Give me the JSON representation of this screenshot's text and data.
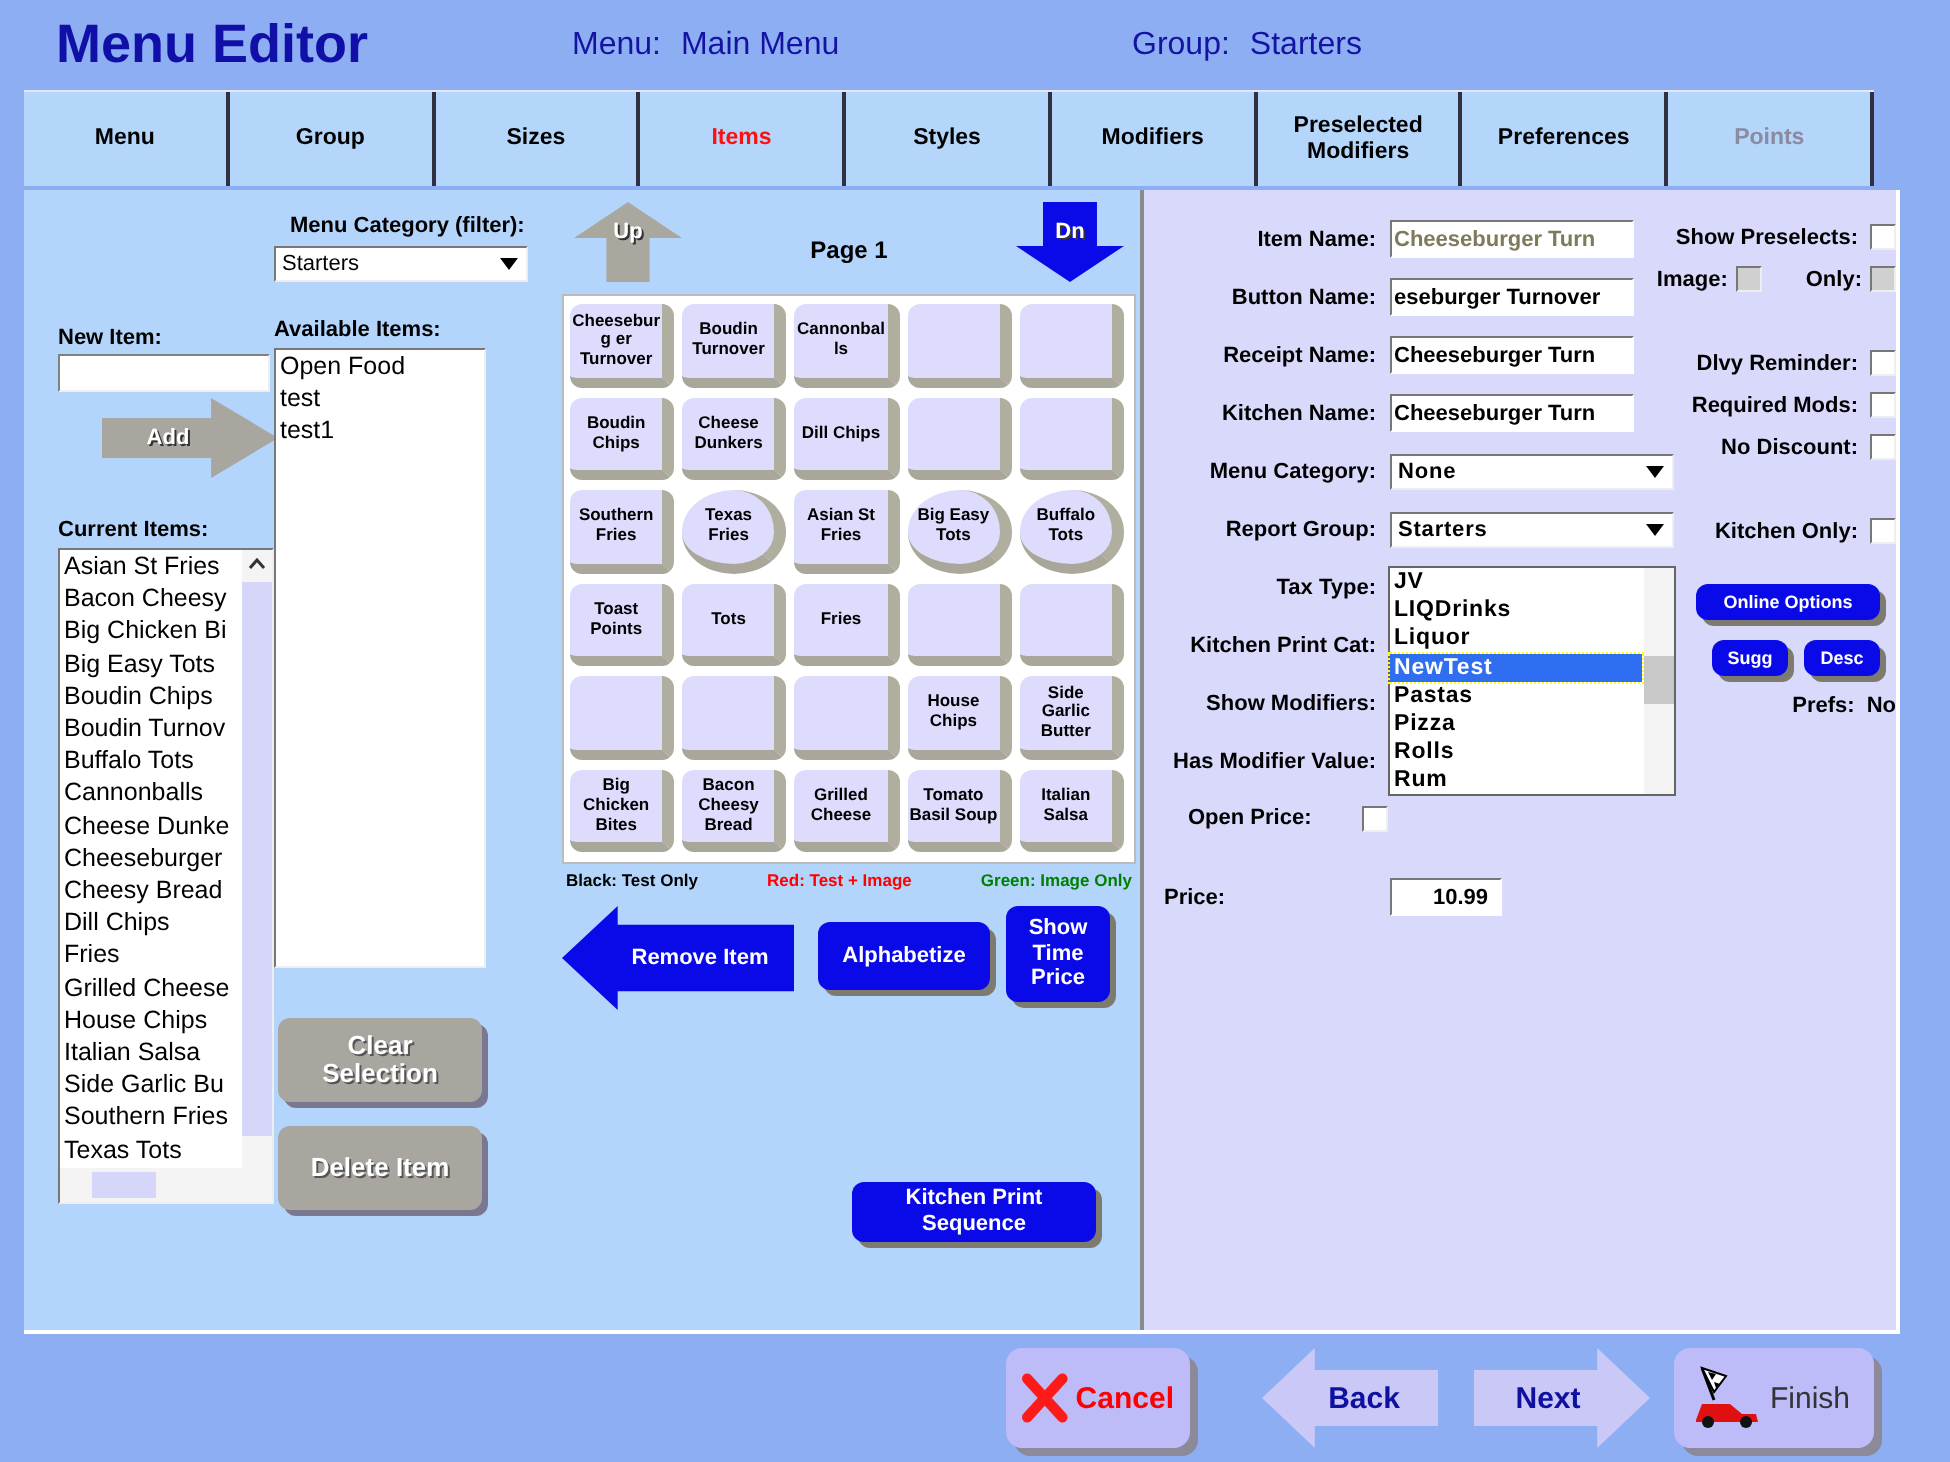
{
  "header": {
    "title": "Menu Editor",
    "menu_label": "Menu:",
    "menu_value": "Main Menu",
    "group_label": "Group:",
    "group_value": "Starters"
  },
  "tabs": [
    {
      "label": "Menu",
      "selected": false,
      "disabled": false
    },
    {
      "label": "Group",
      "selected": false,
      "disabled": false
    },
    {
      "label": "Sizes",
      "selected": false,
      "disabled": false
    },
    {
      "label": "Items",
      "selected": true,
      "disabled": false
    },
    {
      "label": "Styles",
      "selected": false,
      "disabled": false
    },
    {
      "label": "Modifiers",
      "selected": false,
      "disabled": false
    },
    {
      "label": "Preselected Modifiers",
      "selected": false,
      "disabled": false
    },
    {
      "label": "Preferences",
      "selected": false,
      "disabled": false
    },
    {
      "label": "Points",
      "selected": false,
      "disabled": true
    }
  ],
  "new_item": {
    "label": "New Item:",
    "add_button": "Add"
  },
  "current_items": {
    "label": "Current Items:",
    "items": [
      "Asian St Fries",
      "Bacon Cheesy",
      "Big Chicken Bi",
      "Big Easy Tots",
      "Boudin Chips",
      "Boudin Turnov",
      "Buffalo Tots",
      "Cannonballs",
      "Cheese Dunke",
      "Cheeseburger",
      "Cheesy Bread",
      "Dill Chips",
      "Fries",
      "Grilled Cheese",
      "House Chips",
      "Italian Salsa",
      "Side Garlic Bu",
      "Southern Fries",
      "Texas Tots"
    ]
  },
  "filter": {
    "label": "Menu Category (filter):",
    "value": "Starters"
  },
  "available_items": {
    "label": "Available Items:",
    "items": [
      "Open Food",
      "test",
      "test1"
    ]
  },
  "list_buttons": [
    "Clear Selection",
    "Delete Item"
  ],
  "pager": {
    "up": "Up",
    "page": "Page 1",
    "down": "Dn"
  },
  "grid": [
    {
      "kind": "square",
      "label": "Cheeseburg er Turnover"
    },
    {
      "kind": "square",
      "label": "Boudin Turnover"
    },
    {
      "kind": "square",
      "label": "Cannonballs"
    },
    {
      "kind": "blank"
    },
    {
      "kind": "blank"
    },
    {
      "kind": "square",
      "label": "Boudin Chips"
    },
    {
      "kind": "square",
      "label": "Cheese Dunkers"
    },
    {
      "kind": "square",
      "label": "Dill Chips"
    },
    {
      "kind": "blank"
    },
    {
      "kind": "blank"
    },
    {
      "kind": "square",
      "label": "Southern Fries"
    },
    {
      "kind": "round",
      "label": "Texas Fries"
    },
    {
      "kind": "square",
      "label": "Asian St Fries"
    },
    {
      "kind": "round",
      "label": "Big Easy Tots"
    },
    {
      "kind": "round",
      "label": "Buffalo Tots"
    },
    {
      "kind": "square",
      "label": "Toast Points"
    },
    {
      "kind": "square",
      "label": "Tots"
    },
    {
      "kind": "square",
      "label": "Fries"
    },
    {
      "kind": "blank"
    },
    {
      "kind": "blank"
    },
    {
      "kind": "blank"
    },
    {
      "kind": "blank"
    },
    {
      "kind": "blank"
    },
    {
      "kind": "square",
      "label": "House Chips"
    },
    {
      "kind": "square",
      "label": "Side Garlic Butter"
    },
    {
      "kind": "square",
      "label": "Big Chicken Bites"
    },
    {
      "kind": "square",
      "label": "Bacon Cheesy Bread"
    },
    {
      "kind": "square",
      "label": "Grilled Cheese"
    },
    {
      "kind": "square",
      "label": "Tomato Basil Soup"
    },
    {
      "kind": "square",
      "label": "Italian Salsa"
    }
  ],
  "legend": [
    {
      "label": "Black: Test Only",
      "color": "#000000"
    },
    {
      "label": "Red: Test + Image",
      "color": "#ff0000"
    },
    {
      "label": "Green: Image Only",
      "color": "#008000"
    }
  ],
  "actions": {
    "remove": "Remove Item",
    "alphabetize": "Alphabetize",
    "show_time_price": "Show Time Price",
    "kitchen_print_sequence": "Kitchen Print Sequence"
  },
  "form": [
    {
      "kind": "text",
      "label": "Item Name:",
      "value": "Cheeseburger Turn",
      "disabled": true
    },
    {
      "kind": "text",
      "label": "Button Name:",
      "value": "eseburger Turnover",
      "disabled": false
    },
    {
      "kind": "text",
      "label": "Receipt Name:",
      "value": "Cheeseburger Turn",
      "disabled": false
    },
    {
      "kind": "text",
      "label": "Kitchen Name:",
      "value": "Cheeseburger Turn",
      "disabled": false
    },
    {
      "kind": "select",
      "label": "Menu Category:",
      "value": "None"
    },
    {
      "kind": "select",
      "label": "Report Group:",
      "value": "Starters",
      "expanded": true,
      "options": [
        {
          "label": "JV",
          "selected": false
        },
        {
          "label": "LIQDrinks",
          "selected": false
        },
        {
          "label": "Liquor",
          "selected": false
        },
        {
          "label": "NewTest",
          "selected": true
        },
        {
          "label": "Pastas",
          "selected": false
        },
        {
          "label": "Pizza",
          "selected": false
        },
        {
          "label": "Rolls",
          "selected": false
        },
        {
          "label": "Rum",
          "selected": false
        }
      ]
    },
    {
      "kind": "label",
      "label": "Tax Type:"
    },
    {
      "kind": "label",
      "label": "Kitchen Print Cat:"
    },
    {
      "kind": "label",
      "label": "Show Modifiers:"
    },
    {
      "kind": "label",
      "label": "Has Modifier Value:"
    },
    {
      "kind": "check",
      "label": "Open Price:",
      "checked": false
    },
    {
      "kind": "price",
      "label": "Price:",
      "value": "10.99"
    }
  ],
  "options": [
    {
      "kind": "check",
      "label": "Show Preselects:",
      "checked": false,
      "disabled": false
    },
    {
      "kind": "pair",
      "items": [
        {
          "label": "Image:",
          "checked": false,
          "disabled": true
        },
        {
          "label": "Only:",
          "checked": false,
          "disabled": true
        }
      ]
    },
    {
      "kind": "gap"
    },
    {
      "kind": "check",
      "label": "Dlvy Reminder:",
      "checked": false,
      "disabled": false
    },
    {
      "kind": "check",
      "label": "Required Mods:",
      "checked": false,
      "disabled": false
    },
    {
      "kind": "check",
      "label": "No Discount:",
      "checked": false,
      "disabled": false
    },
    {
      "kind": "gap"
    },
    {
      "kind": "check",
      "label": "Kitchen Only:",
      "checked": false,
      "disabled": false
    },
    {
      "kind": "button",
      "label": "Online Options"
    },
    {
      "kind": "buttons",
      "items": [
        "Sugg",
        "Desc"
      ]
    },
    {
      "kind": "info",
      "label": "Prefs:",
      "value": "No"
    }
  ],
  "nav": {
    "cancel": "Cancel",
    "back": "Back",
    "next": "Next",
    "finish": "Finish"
  }
}
